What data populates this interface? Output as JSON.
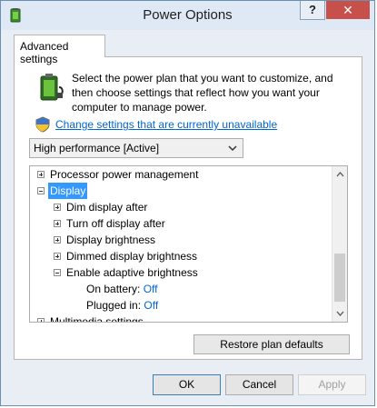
{
  "window": {
    "title": "Power Options",
    "help_label": "?",
    "close_label": "✕"
  },
  "tab": {
    "label": "Advanced settings"
  },
  "description": "Select the power plan that you want to customize, and then choose settings that reflect how you want your computer to manage power.",
  "change_link": "Change settings that are currently unavailable",
  "plan_select": {
    "value": "High performance [Active]"
  },
  "tree": {
    "processor": "Processor power management",
    "display": "Display",
    "dim_display": "Dim display after",
    "turn_off_display": "Turn off display after",
    "display_brightness": "Display brightness",
    "dimmed_brightness": "Dimmed display brightness",
    "adaptive_brightness": "Enable adaptive brightness",
    "on_battery_label": "On battery:",
    "on_battery_value": "Off",
    "plugged_in_label": "Plugged in:",
    "plugged_in_value": "Off",
    "multimedia": "Multimedia settings"
  },
  "buttons": {
    "restore": "Restore plan defaults",
    "ok": "OK",
    "cancel": "Cancel",
    "apply": "Apply"
  },
  "colors": {
    "selection": "#3399ff",
    "link": "#0066cc",
    "close": "#c7504a"
  }
}
